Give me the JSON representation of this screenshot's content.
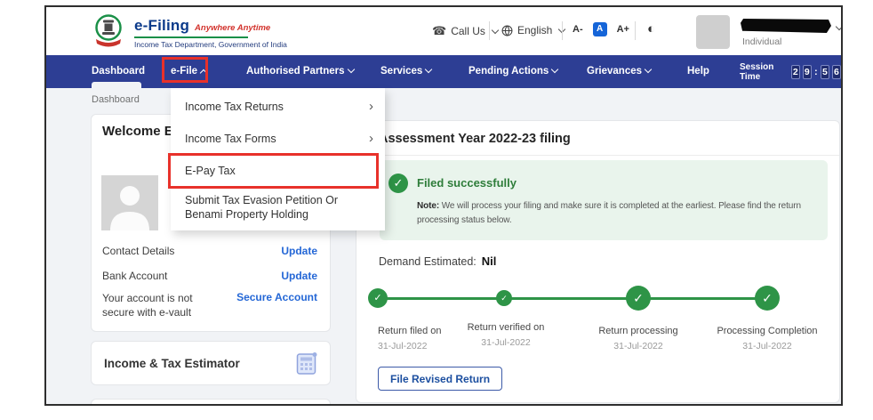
{
  "colors": {
    "navbar_blue": "#2d3e94",
    "annotation_red": "#e8312a",
    "success_green": "#2e9447",
    "link_blue": "#2467d6",
    "page_bg": "#f1f3f6",
    "banner_green_bg": "#e9f4ec"
  },
  "icons": {
    "phone": "☎",
    "contrast": "◐",
    "check": "✓",
    "submenu_arrow": "›"
  },
  "header": {
    "logo_title": "e-Filing",
    "logo_tagline": "Anywhere Anytime",
    "logo_subtitle": "Income Tax Department, Government of India",
    "call_us": "Call Us",
    "language": "English",
    "font_decrease": "A-",
    "font_default": "A",
    "font_increase": "A+",
    "user_role": "Individual"
  },
  "navbar": {
    "items": [
      {
        "label": "Dashboard"
      },
      {
        "label": "e-File"
      },
      {
        "label": "Authorised Partners"
      },
      {
        "label": "Services"
      },
      {
        "label": "Pending Actions"
      },
      {
        "label": "Grievances"
      },
      {
        "label": "Help"
      }
    ],
    "session_label": "Session Time",
    "session_time": [
      "2",
      "9",
      ":",
      "5",
      "6"
    ]
  },
  "breadcrumb": "Dashboard",
  "efile_menu": {
    "items": [
      {
        "label": "Income Tax Returns"
      },
      {
        "label": "Income Tax Forms"
      },
      {
        "label": "E-Pay Tax"
      },
      {
        "label": "Submit Tax Evasion Petition Or Benami Property Holding"
      }
    ]
  },
  "welcome_card": {
    "title": "Welcome E",
    "rows": [
      {
        "label": "Contact Details",
        "action": "Update"
      },
      {
        "label": "Bank Account",
        "action": "Update"
      },
      {
        "label": "Your account is not secure with e-vault",
        "action": "Secure Account"
      }
    ]
  },
  "estimator_card": {
    "title": "Income & Tax Estimator"
  },
  "filing_card": {
    "title": "Assessment Year 2022-23 filing",
    "status_title": "Filed successfully",
    "note_label": "Note:",
    "note_text": " We will process your filing and make sure it is completed at the earliest. Please find the return processing status below.",
    "demand_label": "Demand Estimated:",
    "demand_value": "Nil",
    "timeline": [
      {
        "label": "Return filed on",
        "date": "31-Jul-2022"
      },
      {
        "label": "Return verified on",
        "date": "31-Jul-2022"
      },
      {
        "label": "Return processing",
        "date": "31-Jul-2022"
      },
      {
        "label": "Processing Completion",
        "date": "31-Jul-2022"
      }
    ],
    "revise_button": "File Revised Return"
  }
}
